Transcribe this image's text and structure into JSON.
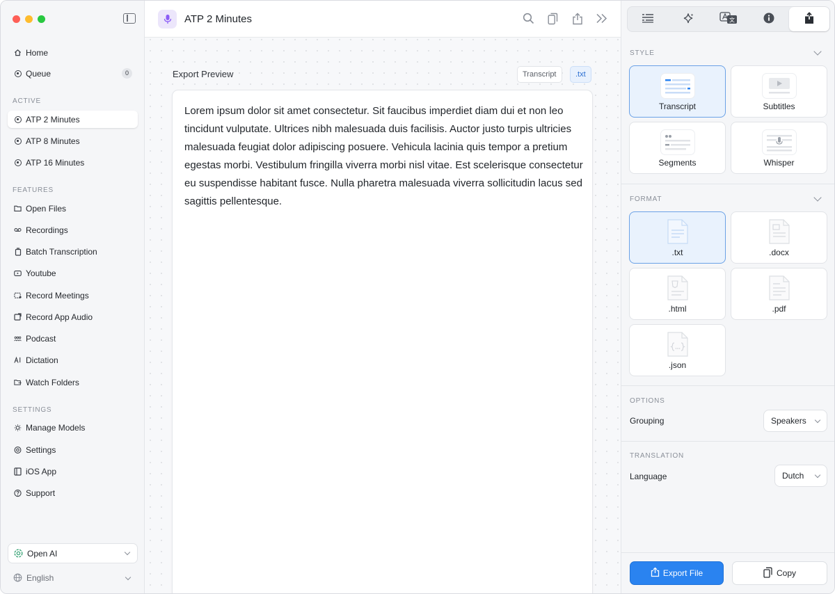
{
  "app": {
    "page_title": "ATP 2 Minutes"
  },
  "colors": {
    "accent": "#2a83f0",
    "traffic_red": "#fe5f57",
    "traffic_yellow": "#febc2e",
    "traffic_green": "#28c840",
    "mic_purple": "#8b5cf6"
  },
  "sidebar": {
    "top_items": [
      {
        "label": "Home",
        "icon": "house-icon"
      },
      {
        "label": "Queue",
        "icon": "queue-icon",
        "badge": "0"
      }
    ],
    "sections": [
      {
        "label": "ACTIVE",
        "items": [
          {
            "label": "ATP 2 Minutes",
            "icon": "record-icon"
          },
          {
            "label": "ATP 8 Minutes",
            "icon": "record-icon"
          },
          {
            "label": "ATP 16 Minutes",
            "icon": "record-icon"
          }
        ]
      },
      {
        "label": "FEATURES",
        "items": [
          {
            "label": "Open Files",
            "icon": "folder-icon"
          },
          {
            "label": "Recordings",
            "icon": "voicemail-icon"
          },
          {
            "label": "Batch Transcription",
            "icon": "batch-icon"
          },
          {
            "label": "Youtube",
            "icon": "youtube-icon"
          },
          {
            "label": "Record Meetings",
            "icon": "meeting-icon"
          },
          {
            "label": "Record App Audio",
            "icon": "app-audio-icon"
          },
          {
            "label": "Podcast",
            "icon": "people-icon"
          },
          {
            "label": "Dictation",
            "icon": "dictation-icon"
          },
          {
            "label": "Watch Folders",
            "icon": "watch-folder-icon"
          }
        ]
      },
      {
        "label": "SETTINGS",
        "items": [
          {
            "label": "Manage Models",
            "icon": "models-icon"
          },
          {
            "label": "Settings",
            "icon": "settings-icon"
          },
          {
            "label": "iOS App",
            "icon": "phone-icon"
          },
          {
            "label": "Support",
            "icon": "help-icon"
          }
        ]
      }
    ],
    "engine": "Open AI",
    "language": "English"
  },
  "main": {
    "export_preview_label": "Export Preview",
    "chips": {
      "style": "Transcript",
      "format": ".txt"
    },
    "preview_text": "Lorem ipsum dolor sit amet consectetur. Sit faucibus imperdiet diam dui et non leo tincidunt vulputate. Ultrices nibh malesuada duis facilisis. Auctor justo turpis ultricies malesuada feugiat dolor adipiscing posuere. Vehicula lacinia quis tempor a pretium egestas morbi. Vestibulum fringilla viverra morbi nisl vitae. Est scelerisque consectetur eu suspendisse habitant fusce. Nulla pharetra malesuada viverra sollicitudin lacus sed sagittis pellentesque."
  },
  "panel": {
    "tabs": [
      "transcript-tab",
      "ai-tab",
      "translate-tab",
      "info-tab",
      "export-tab"
    ],
    "style_label": "STYLE",
    "styles": [
      "Transcript",
      "Subtitles",
      "Segments",
      "Whisper"
    ],
    "format_label": "FORMAT",
    "formats": [
      ".txt",
      ".docx",
      ".html",
      ".pdf",
      ".json"
    ],
    "options_label": "OPTIONS",
    "grouping_label": "Grouping",
    "grouping_value": "Speakers",
    "translation_label": "TRANSLATION",
    "language_label": "Language",
    "language_value": "Dutch",
    "export_button": "Export File",
    "copy_button": "Copy"
  }
}
